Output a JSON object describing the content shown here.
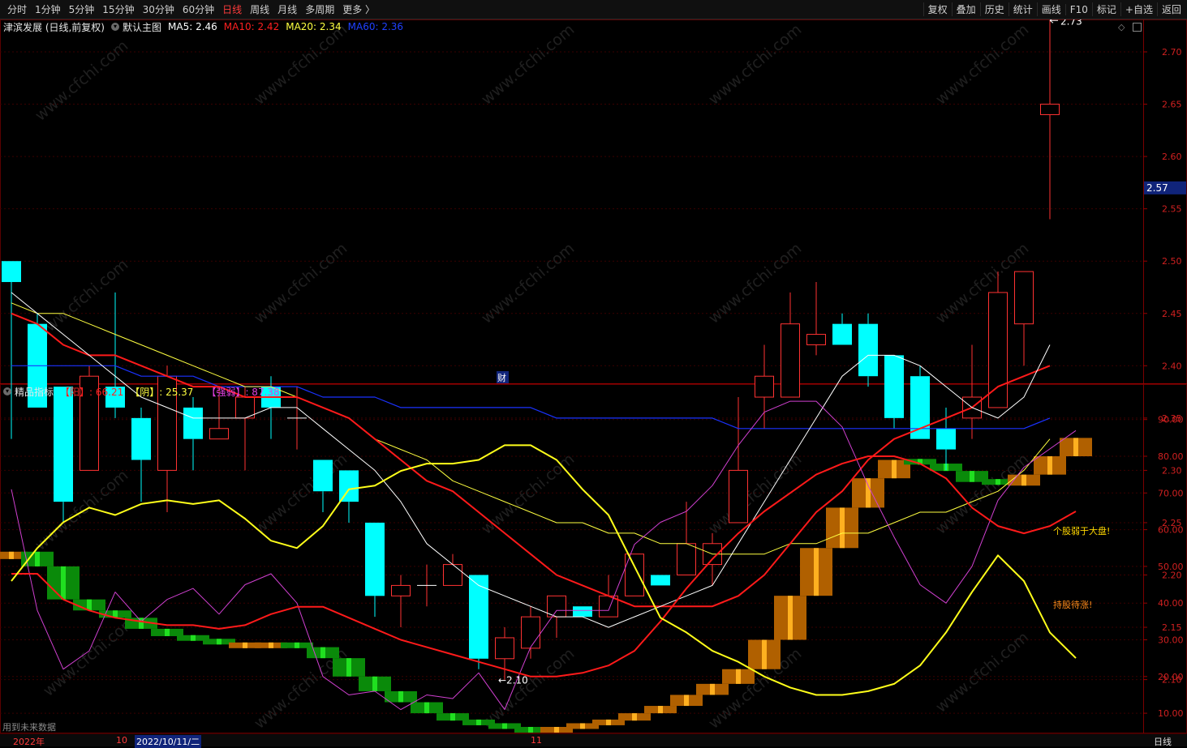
{
  "toolbar": {
    "periods": [
      {
        "label": "分时",
        "active": false
      },
      {
        "label": "1分钟",
        "active": false
      },
      {
        "label": "5分钟",
        "active": false
      },
      {
        "label": "15分钟",
        "active": false
      },
      {
        "label": "30分钟",
        "active": false
      },
      {
        "label": "60分钟",
        "active": false
      },
      {
        "label": "日线",
        "active": true
      },
      {
        "label": "周线",
        "active": false
      },
      {
        "label": "月线",
        "active": false
      },
      {
        "label": "多周期",
        "active": false
      },
      {
        "label": "更多 〉",
        "active": false
      }
    ],
    "actions": [
      "复权",
      "叠加",
      "历史",
      "统计",
      "画线",
      "F10",
      "标记",
      "+自选",
      "返回"
    ]
  },
  "main_panel": {
    "stock_title": "津滨发展 (日线,前复权)",
    "template_label": "默认主图",
    "ma": [
      {
        "label": "MA5: 2.46",
        "color": "#ffffff"
      },
      {
        "label": "MA10: 2.42",
        "color": "#ff2020"
      },
      {
        "label": "MA20: 2.34",
        "color": "#ffff40"
      },
      {
        "label": "MA60: 2.36",
        "color": "#2040ff"
      }
    ],
    "price_ticks": [
      "2.70",
      "2.65",
      "2.60",
      "2.55",
      "2.50",
      "2.45",
      "2.40",
      "2.35",
      "2.30",
      "2.25",
      "2.20",
      "2.15",
      "2.10"
    ],
    "current_price": "2.57",
    "high_label": "2.73",
    "low_label": "←2.10",
    "finance_marker": "财"
  },
  "sub_panel": {
    "title": "精品指标",
    "values": [
      {
        "label": "【阳】: 66.21",
        "color": "#ff2020"
      },
      {
        "label": "【阴】: 25.37",
        "color": "#ffff40"
      },
      {
        "label": "【强弱】: 87.38",
        "color": "#e040e0"
      }
    ],
    "y_ticks": [
      "90.00",
      "80.00",
      "70.00",
      "60.00",
      "50.00",
      "40.00",
      "30.00",
      "20.00",
      "10.00"
    ],
    "annotations": [
      {
        "text": "个股弱于大盘!",
        "color": "#ffd700"
      },
      {
        "text": "持股待涨!",
        "color": "#ff8c1a"
      }
    ],
    "footer_note": "用到未来数据"
  },
  "bottom_bar": {
    "year_label": "2022年",
    "month_10": "10",
    "cursor_date": "2022/10/11/二",
    "month_11": "11",
    "period_label": "日线"
  },
  "watermark": "www.cfchi.com",
  "colors": {
    "up": "#ff3232",
    "down": "#00ffff",
    "ma5": "#ffffff",
    "ma10": "#ff1a1a",
    "ma20": "#ffff40",
    "ma60": "#1a32ff",
    "yang": "#ff1a1a",
    "yin": "#ffff1a",
    "strength": "#d040d0"
  },
  "chart_data": [
    {
      "type": "candlestick",
      "name": "津滨发展",
      "y_range": [
        2.08,
        2.76
      ],
      "candles": [
        {
          "o": 2.5,
          "h": 2.5,
          "l": 2.33,
          "c": 2.48
        },
        {
          "o": 2.44,
          "h": 2.45,
          "l": 2.36,
          "c": 2.36
        },
        {
          "o": 2.38,
          "h": 2.38,
          "l": 2.25,
          "c": 2.27
        },
        {
          "o": 2.3,
          "h": 2.4,
          "l": 2.3,
          "c": 2.39
        },
        {
          "o": 2.38,
          "h": 2.47,
          "l": 2.35,
          "c": 2.36
        },
        {
          "o": 2.35,
          "h": 2.36,
          "l": 2.27,
          "c": 2.31
        },
        {
          "o": 2.3,
          "h": 2.4,
          "l": 2.26,
          "c": 2.39
        },
        {
          "o": 2.36,
          "h": 2.37,
          "l": 2.3,
          "c": 2.33
        },
        {
          "o": 2.33,
          "h": 2.38,
          "l": 2.33,
          "c": 2.34
        },
        {
          "o": 2.35,
          "h": 2.38,
          "l": 2.3,
          "c": 2.37
        },
        {
          "o": 2.38,
          "h": 2.39,
          "l": 2.33,
          "c": 2.36
        },
        {
          "o": 2.35,
          "h": 2.38,
          "l": 2.32,
          "c": 2.35
        },
        {
          "o": 2.31,
          "h": 2.31,
          "l": 2.26,
          "c": 2.28
        },
        {
          "o": 2.3,
          "h": 2.3,
          "l": 2.25,
          "c": 2.27
        },
        {
          "o": 2.25,
          "h": 2.25,
          "l": 2.16,
          "c": 2.18
        },
        {
          "o": 2.18,
          "h": 2.2,
          "l": 2.15,
          "c": 2.19
        },
        {
          "o": 2.19,
          "h": 2.21,
          "l": 2.17,
          "c": 2.19
        },
        {
          "o": 2.19,
          "h": 2.22,
          "l": 2.19,
          "c": 2.21
        },
        {
          "o": 2.2,
          "h": 2.2,
          "l": 2.11,
          "c": 2.12
        },
        {
          "o": 2.12,
          "h": 2.15,
          "l": 2.1,
          "c": 2.14
        },
        {
          "o": 2.13,
          "h": 2.17,
          "l": 2.12,
          "c": 2.16
        },
        {
          "o": 2.16,
          "h": 2.18,
          "l": 2.14,
          "c": 2.18
        },
        {
          "o": 2.17,
          "h": 2.17,
          "l": 2.16,
          "c": 2.16
        },
        {
          "o": 2.16,
          "h": 2.2,
          "l": 2.16,
          "c": 2.18
        },
        {
          "o": 2.18,
          "h": 2.22,
          "l": 2.18,
          "c": 2.22
        },
        {
          "o": 2.2,
          "h": 2.2,
          "l": 2.19,
          "c": 2.19
        },
        {
          "o": 2.2,
          "h": 2.27,
          "l": 2.2,
          "c": 2.23
        },
        {
          "o": 2.21,
          "h": 2.24,
          "l": 2.19,
          "c": 2.23
        },
        {
          "o": 2.25,
          "h": 2.37,
          "l": 2.25,
          "c": 2.3
        },
        {
          "o": 2.37,
          "h": 2.42,
          "l": 2.34,
          "c": 2.39
        },
        {
          "o": 2.37,
          "h": 2.47,
          "l": 2.37,
          "c": 2.44
        },
        {
          "o": 2.42,
          "h": 2.48,
          "l": 2.41,
          "c": 2.43
        },
        {
          "o": 2.44,
          "h": 2.45,
          "l": 2.42,
          "c": 2.42
        },
        {
          "o": 2.44,
          "h": 2.45,
          "l": 2.38,
          "c": 2.39
        },
        {
          "o": 2.41,
          "h": 2.41,
          "l": 2.34,
          "c": 2.35
        },
        {
          "o": 2.39,
          "h": 2.4,
          "l": 2.33,
          "c": 2.33
        },
        {
          "o": 2.34,
          "h": 2.36,
          "l": 2.3,
          "c": 2.32
        },
        {
          "o": 2.35,
          "h": 2.42,
          "l": 2.33,
          "c": 2.37
        },
        {
          "o": 2.36,
          "h": 2.49,
          "l": 2.36,
          "c": 2.47
        },
        {
          "o": 2.44,
          "h": 2.49,
          "l": 2.4,
          "c": 2.49
        },
        {
          "o": 2.64,
          "h": 2.73,
          "l": 2.54,
          "c": 2.65
        }
      ],
      "ma5": [
        2.47,
        2.45,
        2.43,
        2.41,
        2.39,
        2.37,
        2.36,
        2.35,
        2.35,
        2.35,
        2.36,
        2.36,
        2.34,
        2.32,
        2.3,
        2.27,
        2.23,
        2.21,
        2.19,
        2.18,
        2.17,
        2.16,
        2.16,
        2.15,
        2.16,
        2.17,
        2.18,
        2.19,
        2.23,
        2.27,
        2.31,
        2.35,
        2.39,
        2.41,
        2.41,
        2.4,
        2.38,
        2.36,
        2.35,
        2.37,
        2.42
      ],
      "ma10": [
        2.45,
        2.44,
        2.42,
        2.41,
        2.41,
        2.4,
        2.39,
        2.38,
        2.38,
        2.37,
        2.37,
        2.37,
        2.36,
        2.35,
        2.33,
        2.31,
        2.29,
        2.28,
        2.26,
        2.24,
        2.22,
        2.2,
        2.19,
        2.18,
        2.17,
        2.17,
        2.17,
        2.17,
        2.18,
        2.2,
        2.23,
        2.26,
        2.28,
        2.31,
        2.33,
        2.34,
        2.35,
        2.36,
        2.38,
        2.39,
        2.4
      ],
      "ma20": [
        2.46,
        2.45,
        2.45,
        2.44,
        2.43,
        2.42,
        2.41,
        2.4,
        2.39,
        2.38,
        2.38,
        2.37,
        2.36,
        2.35,
        2.33,
        2.32,
        2.31,
        2.29,
        2.28,
        2.27,
        2.26,
        2.25,
        2.25,
        2.24,
        2.24,
        2.23,
        2.23,
        2.22,
        2.22,
        2.22,
        2.23,
        2.23,
        2.24,
        2.24,
        2.25,
        2.26,
        2.26,
        2.27,
        2.28,
        2.3,
        2.33
      ],
      "ma60": [
        2.4,
        2.4,
        2.4,
        2.4,
        2.4,
        2.39,
        2.39,
        2.39,
        2.38,
        2.38,
        2.38,
        2.38,
        2.37,
        2.37,
        2.37,
        2.36,
        2.36,
        2.36,
        2.36,
        2.36,
        2.36,
        2.35,
        2.35,
        2.35,
        2.35,
        2.35,
        2.35,
        2.35,
        2.34,
        2.34,
        2.34,
        2.34,
        2.34,
        2.34,
        2.34,
        2.34,
        2.34,
        2.34,
        2.34,
        2.34,
        2.35
      ]
    },
    {
      "type": "line",
      "name": "精品指标",
      "y_range": [
        5,
        98
      ],
      "series": [
        {
          "name": "【阳】",
          "values": [
            48,
            48,
            41,
            38,
            36,
            35,
            34,
            34,
            33,
            34,
            37,
            39,
            39,
            36,
            33,
            30,
            28,
            26,
            24,
            22,
            20,
            20,
            21,
            23,
            27,
            35,
            44,
            52,
            59,
            65,
            70,
            75,
            78,
            80,
            80,
            78,
            74,
            66,
            61,
            59,
            61,
            65
          ]
        },
        {
          "name": "【阴】",
          "values": [
            46,
            55,
            62,
            66,
            64,
            67,
            68,
            67,
            68,
            63,
            57,
            55,
            61,
            71,
            72,
            76,
            78,
            78,
            79,
            83,
            83,
            79,
            71,
            64,
            50,
            36,
            32,
            27,
            24,
            20,
            17,
            15,
            15,
            16,
            18,
            23,
            32,
            43,
            53,
            46,
            32,
            25
          ]
        },
        {
          "name": "【强弱】",
          "values": [
            71,
            38,
            22,
            27,
            43,
            35,
            41,
            44,
            37,
            45,
            48,
            40,
            20,
            15,
            16,
            11,
            15,
            14,
            21,
            11,
            28,
            38,
            38,
            38,
            56,
            62,
            65,
            72,
            83,
            92,
            95,
            95,
            88,
            72,
            58,
            45,
            40,
            50,
            68,
            77,
            82,
            87
          ]
        }
      ],
      "bars": [
        {
          "from": 52,
          "to": 54,
          "kind": "up"
        },
        {
          "from": 54,
          "to": 50,
          "kind": "down"
        },
        {
          "from": 50,
          "to": 41,
          "kind": "down"
        },
        {
          "from": 41,
          "to": 38,
          "kind": "down"
        },
        {
          "from": 38,
          "to": 36,
          "kind": "down"
        },
        {
          "from": 36,
          "to": 33,
          "kind": "down"
        },
        {
          "from": 33,
          "to": 31,
          "kind": "down"
        },
        {
          "from": 31,
          "to": 30,
          "kind": "down"
        },
        {
          "from": 30,
          "to": 29,
          "kind": "down"
        },
        {
          "from": 28,
          "to": 29,
          "kind": "up"
        },
        {
          "from": 28,
          "to": 29,
          "kind": "up"
        },
        {
          "from": 29,
          "to": 28,
          "kind": "down"
        },
        {
          "from": 28,
          "to": 25,
          "kind": "down"
        },
        {
          "from": 25,
          "to": 20,
          "kind": "down"
        },
        {
          "from": 20,
          "to": 16,
          "kind": "down"
        },
        {
          "from": 16,
          "to": 13,
          "kind": "down"
        },
        {
          "from": 13,
          "to": 10,
          "kind": "down"
        },
        {
          "from": 10,
          "to": 8,
          "kind": "down"
        },
        {
          "from": 8,
          "to": 7,
          "kind": "down"
        },
        {
          "from": 7,
          "to": 6,
          "kind": "down"
        },
        {
          "from": 6,
          "to": 5,
          "kind": "down"
        },
        {
          "from": 5,
          "to": 6,
          "kind": "up"
        },
        {
          "from": 6,
          "to": 7,
          "kind": "up"
        },
        {
          "from": 7,
          "to": 8,
          "kind": "up"
        },
        {
          "from": 8,
          "to": 10,
          "kind": "up"
        },
        {
          "from": 10,
          "to": 12,
          "kind": "up"
        },
        {
          "from": 12,
          "to": 15,
          "kind": "up"
        },
        {
          "from": 15,
          "to": 18,
          "kind": "up"
        },
        {
          "from": 18,
          "to": 22,
          "kind": "up"
        },
        {
          "from": 22,
          "to": 30,
          "kind": "up"
        },
        {
          "from": 30,
          "to": 42,
          "kind": "up"
        },
        {
          "from": 42,
          "to": 55,
          "kind": "up"
        },
        {
          "from": 55,
          "to": 66,
          "kind": "up"
        },
        {
          "from": 66,
          "to": 74,
          "kind": "up"
        },
        {
          "from": 74,
          "to": 79,
          "kind": "up"
        },
        {
          "from": 79,
          "to": 78,
          "kind": "down"
        },
        {
          "from": 78,
          "to": 76,
          "kind": "down"
        },
        {
          "from": 76,
          "to": 73,
          "kind": "down"
        },
        {
          "from": 73,
          "to": 73,
          "kind": "down"
        },
        {
          "from": 72,
          "to": 75,
          "kind": "up"
        },
        {
          "from": 75,
          "to": 80,
          "kind": "up"
        },
        {
          "from": 80,
          "to": 85,
          "kind": "up"
        }
      ]
    }
  ]
}
